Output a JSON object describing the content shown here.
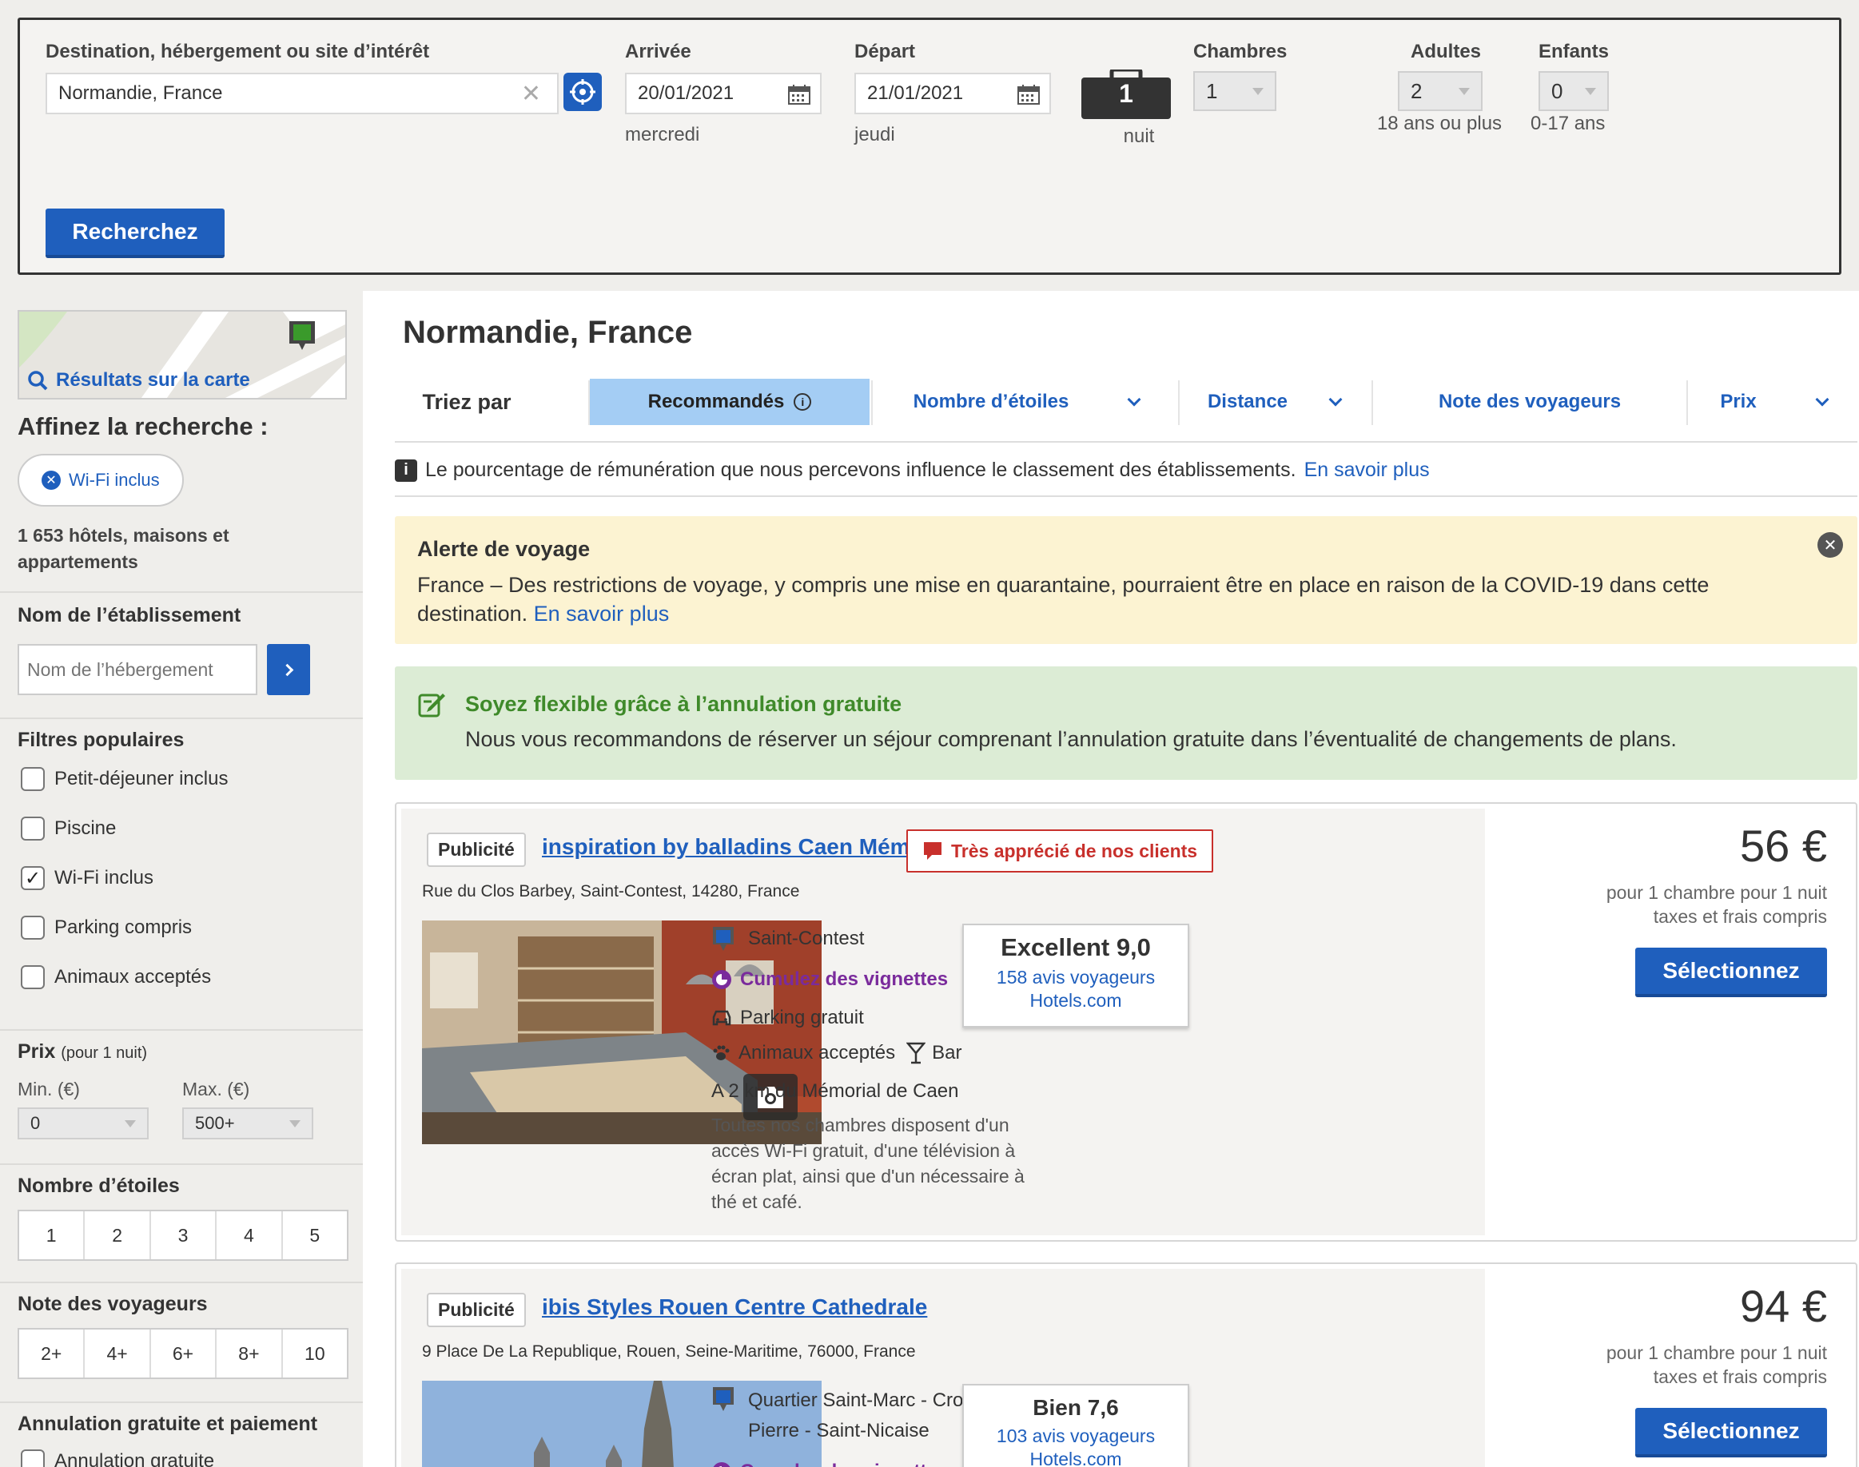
{
  "search": {
    "destination_label": "Destination, hébergement ou site d’intérêt",
    "destination_value": "Normandie, France",
    "arrival_label": "Arrivée",
    "arrival_value": "20/01/2021",
    "arrival_day": "mercredi",
    "departure_label": "Départ",
    "departure_value": "21/01/2021",
    "departure_day": "jeudi",
    "nights_value": "1",
    "nights_label": "nuit",
    "rooms_label": "Chambres",
    "rooms_value": "1",
    "adults_label": "Adultes",
    "adults_value": "2",
    "adults_sub": "18 ans ou plus",
    "children_label": "Enfants",
    "children_value": "0",
    "children_sub": "0-17 ans",
    "search_button": "Recherchez"
  },
  "sidebar": {
    "map_link": "Résultats sur la carte",
    "refine_title": "Affinez la recherche :",
    "active_filter": "Wi-Fi inclus",
    "result_count": "1 653 hôtels, maisons et appartements",
    "name_title": "Nom de l’établissement",
    "name_placeholder": "Nom de l’hébergement",
    "popular_title": "Filtres populaires",
    "popular_filters": [
      {
        "label": "Petit-déjeuner inclus",
        "checked": false
      },
      {
        "label": "Piscine",
        "checked": false
      },
      {
        "label": "Wi-Fi inclus",
        "checked": true
      },
      {
        "label": "Parking compris",
        "checked": false
      },
      {
        "label": "Animaux acceptés",
        "checked": false
      }
    ],
    "price_title": "Prix",
    "price_sub": "(pour 1 nuit)",
    "price_min_label": "Min. (€)",
    "price_min_value": "0",
    "price_max_label": "Max. (€)",
    "price_max_value": "500+",
    "stars_title": "Nombre d’étoiles",
    "stars": [
      "1",
      "2",
      "3",
      "4",
      "5"
    ],
    "rating_title": "Note des voyageurs",
    "ratings": [
      "2+",
      "4+",
      "6+",
      "8+",
      "10"
    ],
    "cancel_title": "Annulation gratuite et paiement",
    "cancel_option": "Annulation gratuite"
  },
  "main": {
    "title": "Normandie, France",
    "sort_label": "Triez par",
    "sort_options": [
      "Recommandés",
      "Nombre d’étoiles",
      "Distance",
      "Note des voyageurs",
      "Prix"
    ],
    "info_text": "Le pourcentage de rémunération que nous percevons influence le classement des établissements.",
    "info_link": "En savoir plus",
    "alert_title": "Alerte de voyage",
    "alert_text": "France – Des restrictions de voyage, y compris une mise en quarantaine, pourraient être en place en raison de la COVID-19 dans cette destination.",
    "alert_link": "En savoir plus",
    "flex_title": "Soyez flexible grâce à l’annulation gratuite",
    "flex_text": "Nous vous recommandons de réserver un séjour comprenant l’annulation gratuite dans l’éventualité de changements de plans."
  },
  "hotels": [
    {
      "badge": "Publicité",
      "name": "inspiration by balladins Caen Mémorial",
      "address": "Rue du Clos Barbey, Saint-Contest, 14280, France",
      "tag": "Très apprécié de nos clients",
      "location": "Saint-Contest",
      "loyalty": "Cumulez des vignettes",
      "amenity1": "Parking gratuit",
      "amenity2": "Animaux acceptés",
      "amenity3": "Bar",
      "landmark": "A 2 km du Mémorial de Caen",
      "description": "Toutes nos chambres disposent d'un accès Wi-Fi gratuit, d'une télévision à écran plat, ainsi que d'un nécessaire à thé et café.",
      "rating_label": "Excellent 9,0",
      "reviews": "158 avis voyageurs",
      "review_source": "Hotels.com",
      "price": "56 €",
      "price_note1": "pour 1 chambre pour 1 nuit",
      "price_note2": "taxes et frais compris",
      "select": "Sélectionnez"
    },
    {
      "badge": "Publicité",
      "name": "ibis Styles Rouen Centre Cathedrale",
      "address": "9 Place De La Republique, Rouen, Seine-Maritime, 76000, France",
      "location": "Quartier Saint-Marc - Croix de Pierre - Saint-Nicaise",
      "loyalty": "Cumulez des vignettes",
      "rating_label": "Bien 7,6",
      "reviews": "103 avis voyageurs",
      "review_source": "Hotels.com",
      "price": "94 €",
      "price_note1": "pour 1 chambre pour 1 nuit",
      "price_note2": "taxes et frais compris",
      "select": "Sélectionnez"
    }
  ],
  "colors": {
    "accent": "#1f5fbd",
    "alert_bg": "#fcf3d2",
    "flex_bg": "#dcecd5",
    "flex_title": "#3f8a2a",
    "tag_red": "#c8302c",
    "loyalty_purple": "#7a2b9c"
  }
}
